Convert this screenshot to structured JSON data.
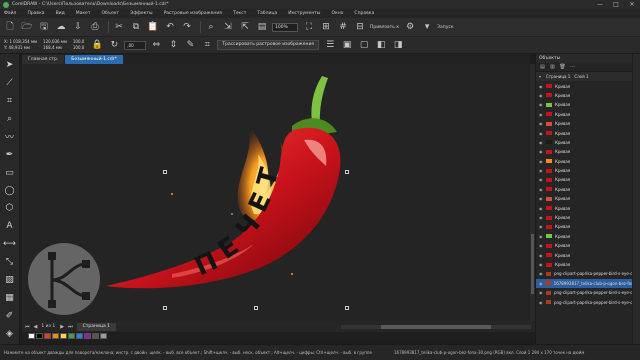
{
  "window": {
    "title": "CorelDRAW - C:\\Users\\Пользователь\\Downloads\\Безымянный-1.cdr*",
    "controls": [
      "—",
      "□",
      "✕"
    ]
  },
  "menu": [
    "Файл",
    "Правка",
    "Вид",
    "Макет",
    "Объект",
    "Эффекты",
    "Растровые изображения",
    "Текст",
    "Таблица",
    "Инструменты",
    "Окно",
    "Справка"
  ],
  "toolbar": {
    "zoom": "100%",
    "trace_button": "Трассировать растровое изображение",
    "snap_label": "Привязать к",
    "launch_label": "Запуск"
  },
  "propbar": {
    "x": "X: 1 018,354 мм",
    "y": "Y: 48,931 мм",
    "w": "120,036 мм",
    "h": "168,4 мм",
    "scale_w": "100,0",
    "scale_h": "100,0",
    "angle": ",00"
  },
  "doc_tabs": [
    "Главная стр.",
    "Безымянный-1.cdr*"
  ],
  "objects": {
    "title": "Объекты",
    "page": "Страница 1",
    "layer": "Слой 1",
    "curve_label": "Кривая",
    "curve_count": 20,
    "png_items": [
      "png-clipart-paprika-pepper-bird-s-eye-chi...",
      "1678993817_telika-club-p-ogon-bez-fona...",
      "png-clipart-paprika-pepper-bird-s-eye-chi...",
      "png-clipart-paprika-pepper-bird-s-eye-chi..."
    ],
    "selected_index": 1
  },
  "pages": {
    "counter": "1 из 1",
    "tab": "Страница 1"
  },
  "artwork": {
    "letters": [
      "П",
      "Е",
      "Ч",
      "Е",
      "Т"
    ],
    "colors": {
      "pepper": "#c8121b",
      "pepper_highlight": "#ff5a4a",
      "stem": "#7ec242",
      "flame": "#ff8a1a",
      "text": "#1a1a1a"
    }
  },
  "status": {
    "hint": "Нажмите на объект дважды для поворота/наклона; инстр. с двойн. щелк. - выб. все объект.; Shift+щелч. - выб. неск. объект.; Alt+щелч. - цифры; Ctrl+щелч. - выб. в группе",
    "info": "1678993817_telika-club-p-ogon-bez-fona-30.png (RGB) вкл. Слой 1 294 x 170 точек на дюйм"
  },
  "palette": [
    "#ffffff",
    "#000000",
    "#e53935",
    "#fb8c00",
    "#fdd835",
    "#43a047",
    "#1e88e5",
    "#8e24aa",
    "#6d4c41",
    "#9e9e9e"
  ]
}
